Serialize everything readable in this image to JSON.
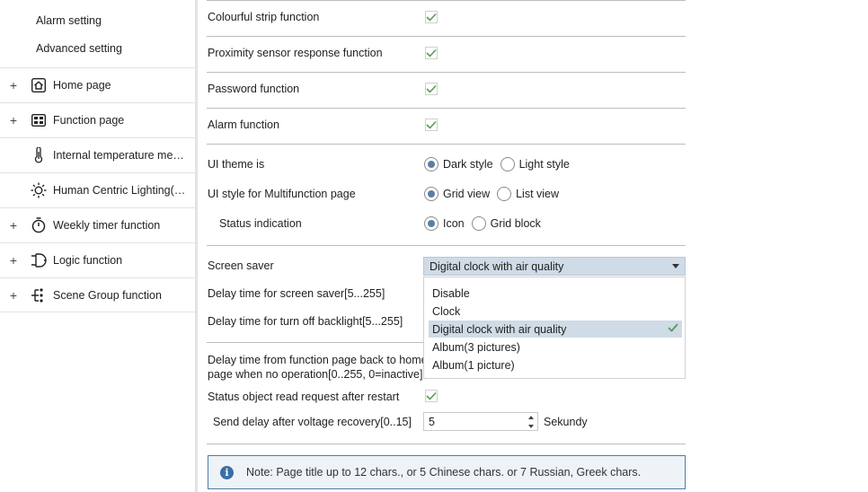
{
  "sidebar": {
    "sub_items": [
      "Alarm setting",
      "Advanced setting"
    ],
    "items": [
      {
        "label": "Home page",
        "expand": "+",
        "icon": "home-icon"
      },
      {
        "label": "Function page",
        "expand": "+",
        "icon": "grid-icon"
      },
      {
        "label": "Internal temperature meas...",
        "expand": "",
        "icon": "thermometer-icon"
      },
      {
        "label": "Human Centric Lighting(H...",
        "expand": "",
        "icon": "sun-icon"
      },
      {
        "label": "Weekly timer function",
        "expand": "+",
        "icon": "timer-icon"
      },
      {
        "label": "Logic function",
        "expand": "+",
        "icon": "logic-icon"
      },
      {
        "label": "Scene Group function",
        "expand": "+",
        "icon": "scene-tree-icon"
      }
    ]
  },
  "params": {
    "colourful_strip": "Colourful strip function",
    "proximity": "Proximity sensor response function",
    "password": "Password function",
    "alarm": "Alarm function",
    "ui_theme": {
      "label": "UI theme is",
      "opt1": "Dark style",
      "opt2": "Light style",
      "selected": "Dark style"
    },
    "ui_style": {
      "label": "UI style for Multifunction page",
      "opt1": "Grid view",
      "opt2": "List view",
      "selected": "Grid view"
    },
    "status_ind": {
      "label": "Status indication",
      "opt1": "Icon",
      "opt2": "Grid block",
      "selected": "Icon"
    },
    "screen_saver": {
      "label": "Screen saver",
      "value": "Digital clock with air quality"
    },
    "delay_saver": "Delay time for screen saver[5...255]",
    "delay_backlight": "Delay time for turn off backlight[5...255]",
    "delay_home_1": "Delay time from function page back to home",
    "delay_home_2": "page when no operation[0..255, 0=inactive]",
    "status_read": "Status object read request after restart",
    "send_delay": {
      "label": "Send delay after voltage recovery[0..15]",
      "value": "5",
      "unit": "Sekundy"
    }
  },
  "dropdown": {
    "options": [
      "Disable",
      "Clock",
      "Digital clock with air quality",
      "Album(3 pictures)",
      "Album(1 picture)"
    ],
    "selected_index": 2
  },
  "note": "Note: Page title up to 12 chars., or 5 Chinese chars. or 7 Russian, Greek chars.",
  "colors": {
    "accent": "#3a6ea5",
    "selection": "#cfdbe6",
    "check": "#5a9a5a"
  }
}
